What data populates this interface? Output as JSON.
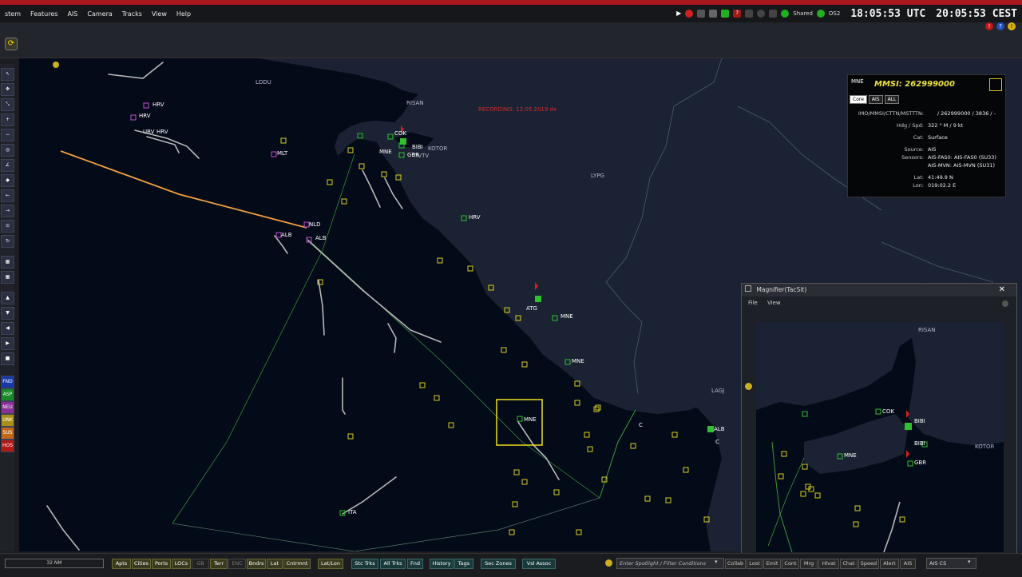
{
  "menubar": {
    "items": [
      "stem",
      "Features",
      "AIS",
      "Camera",
      "Tracks",
      "View",
      "Help"
    ],
    "shared_label": "Shared",
    "os_label": "OS2",
    "utc_time": "18:05:53 UTC",
    "cest_time": "20:05:53 CEST"
  },
  "left_toolbar": {
    "identity_buttons": [
      "FND",
      "ASP",
      "NEU",
      "UNK",
      "SUS",
      "HOS"
    ]
  },
  "map": {
    "recording": "RECORDING: 12.05.2019 dx",
    "places": [
      "LDDU",
      "RISAN",
      "KOTOR",
      "TIVTV",
      "LYPG",
      "LAGJ"
    ],
    "tracks": [
      "HRV",
      "HRV",
      "URV",
      "HRV",
      "MLT",
      "NLD",
      "ALB",
      "ALB",
      "COK",
      "MNE",
      "BIBI",
      "GBR",
      "HRV",
      "ATG",
      "MNE",
      "MNE",
      "MNE",
      "ITA",
      "C",
      "ALB",
      "C"
    ]
  },
  "infopanel": {
    "head": "MNE",
    "mmsi": "MMSI: 262999000",
    "tabs": [
      "Core",
      "AIS",
      "ALL"
    ],
    "rows": [
      {
        "k": "IMO/MMSI/CTTN/MSTTTN:",
        "v": "/ 262999000 / 3836 / -"
      },
      {
        "k": "Hdg / Spd:",
        "v": "322 ° M / 9 kt"
      },
      {
        "k": "Cat:",
        "v": "Surface"
      },
      {
        "k": "Source:",
        "v": "AIS"
      },
      {
        "k": "Sensors:",
        "v": "AIS-FAS0: AIS-FAS0 (SU33)"
      },
      {
        "k": "",
        "v": "AIS-MVN: AIS-MVN (SU31)"
      },
      {
        "k": "Lat:",
        "v": "41:49.9 N"
      },
      {
        "k": "Lon:",
        "v": "019:02.2 E"
      }
    ]
  },
  "magnifier": {
    "title": "Magnifier(TacSit)",
    "menu_file": "File",
    "menu_view": "View",
    "labels": [
      "RISAN",
      "COK",
      "MNE",
      "BIBI",
      "GBR",
      "KOTOR"
    ]
  },
  "bottombar": {
    "scale": "32 NM",
    "buttons_yellow": [
      "Apts",
      "Cities",
      "Ports",
      "LOCs",
      "GB",
      "Terr",
      "ENC",
      "Bndrs",
      "Lat",
      "Cntrmnt",
      "Lat/Lon"
    ],
    "buttons_teal": [
      "Stc Trks",
      "All Trks",
      "Fnd",
      "History",
      "Tags",
      "Sec Zones",
      "Vsl Assoc"
    ],
    "filter_placeholder": "Enter Spotlight / Filter Conditions",
    "buttons_grey": [
      "Collab",
      "Lost",
      "Emit",
      "Cont",
      "Mrg",
      "Hlvat",
      "Chat",
      "Speed",
      "Alert",
      "AIS"
    ],
    "ais_select": "AIS CS"
  }
}
